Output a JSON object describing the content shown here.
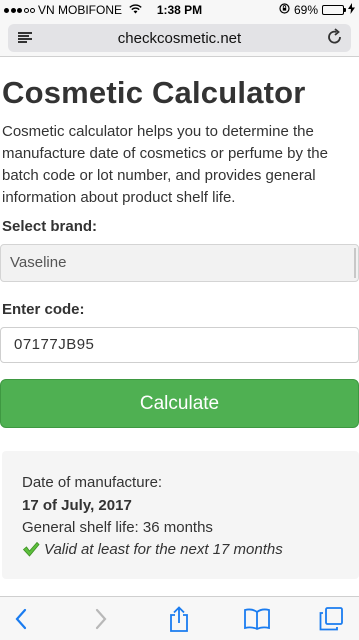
{
  "status_bar": {
    "carrier": "VN MOBIFONE",
    "time": "1:38 PM",
    "battery_percent": "69%",
    "battery_level": 0.69
  },
  "browser": {
    "url": "checkcosmetic.net",
    "icons": {
      "reader": "reader-icon",
      "reload": "reload-icon",
      "back": "back-icon",
      "forward": "forward-icon",
      "share": "share-icon",
      "bookmarks": "bookmarks-icon",
      "tabs": "tabs-icon"
    }
  },
  "page": {
    "title": "Cosmetic Calculator",
    "intro": "Cosmetic calculator helps you to determine the manufacture date of cosmetics or perfume by the batch code or lot number, and provides general information about product shelf life.",
    "brand_label": "Select brand:",
    "brand_value": "Vaseline",
    "code_label": "Enter code:",
    "code_value": "07177JB95",
    "calculate_label": "Calculate"
  },
  "result": {
    "manufacture_label": "Date of manufacture:",
    "manufacture_date": "17 of July, 2017",
    "shelf_life": "General shelf life: 36 months",
    "validity": "Valid at least for the next 17 months"
  },
  "colors": {
    "accent_green": "#4fb052",
    "ios_blue": "#1a7cf0"
  }
}
